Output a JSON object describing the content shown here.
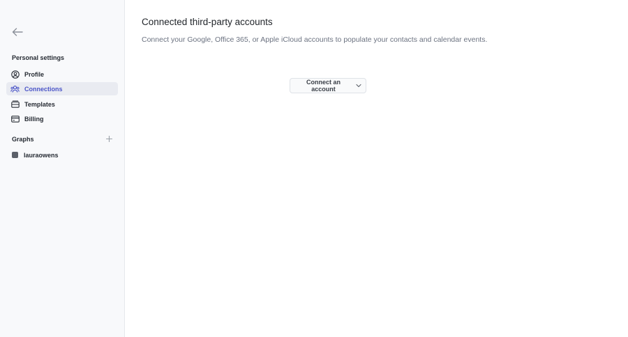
{
  "sidebar": {
    "back_icon": "arrow-left-icon",
    "personal_settings_title": "Personal settings",
    "items": [
      {
        "label": "Profile",
        "icon": "user-circle-icon",
        "active": false
      },
      {
        "label": "Connections",
        "icon": "users-icon",
        "active": true
      },
      {
        "label": "Templates",
        "icon": "template-icon",
        "active": false
      },
      {
        "label": "Billing",
        "icon": "credit-card-icon",
        "active": false
      }
    ],
    "graphs_title": "Graphs",
    "add_graph_icon": "plus-icon",
    "graphs": [
      {
        "label": "lauraowens"
      }
    ]
  },
  "main": {
    "title": "Connected third-party accounts",
    "description": "Connect your Google, Office 365, or Apple iCloud accounts to populate your contacts and calendar events.",
    "connect_button_label": "Connect an account"
  },
  "colors": {
    "accent": "#4b55c8",
    "sidebar_bg": "#f8f9fb",
    "active_bg": "#e9ebf1",
    "muted_text": "#6b7280"
  }
}
